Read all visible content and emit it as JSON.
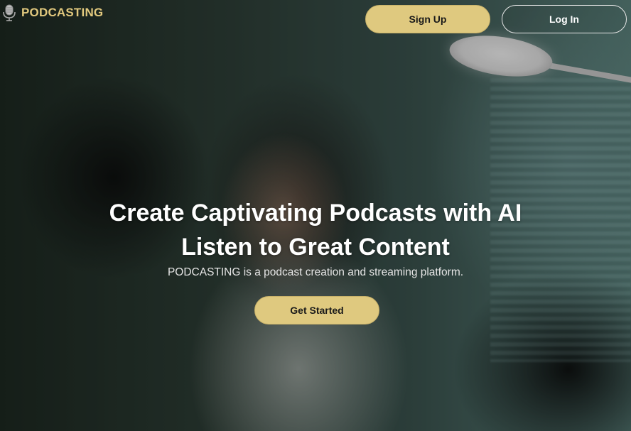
{
  "header": {
    "brand_icon": "microphone-icon",
    "brand_name": "PODCASTING",
    "signup_label": "Sign Up",
    "login_label": "Log In"
  },
  "hero": {
    "title_line1": "Create Captivating Podcasts with AI",
    "title_line2": "Listen to Great Content",
    "subtitle": "PODCASTING is a podcast creation and streaming platform.",
    "cta_label": "Get Started"
  },
  "colors": {
    "accent": "#dfc97f",
    "brand_text": "#e2c97e",
    "hero_text": "#ffffff"
  }
}
